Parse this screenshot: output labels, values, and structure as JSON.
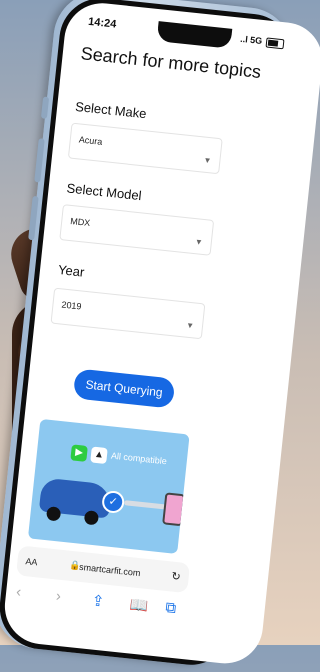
{
  "status": {
    "time": "14:24",
    "signal": "..l 5G"
  },
  "page": {
    "title": "Search for more topics",
    "make_label": "Select Make",
    "make_value": "Acura",
    "model_label": "Select Model",
    "model_value": "MDX",
    "year_label": "Year",
    "year_value": "2019",
    "button_label": "Start Querying"
  },
  "banner": {
    "caption": "All compatible"
  },
  "browser": {
    "text_size": "AA",
    "url": "smartcarfit.com"
  },
  "colors": {
    "accent": "#1668e3",
    "banner": "#8cc8f0"
  }
}
